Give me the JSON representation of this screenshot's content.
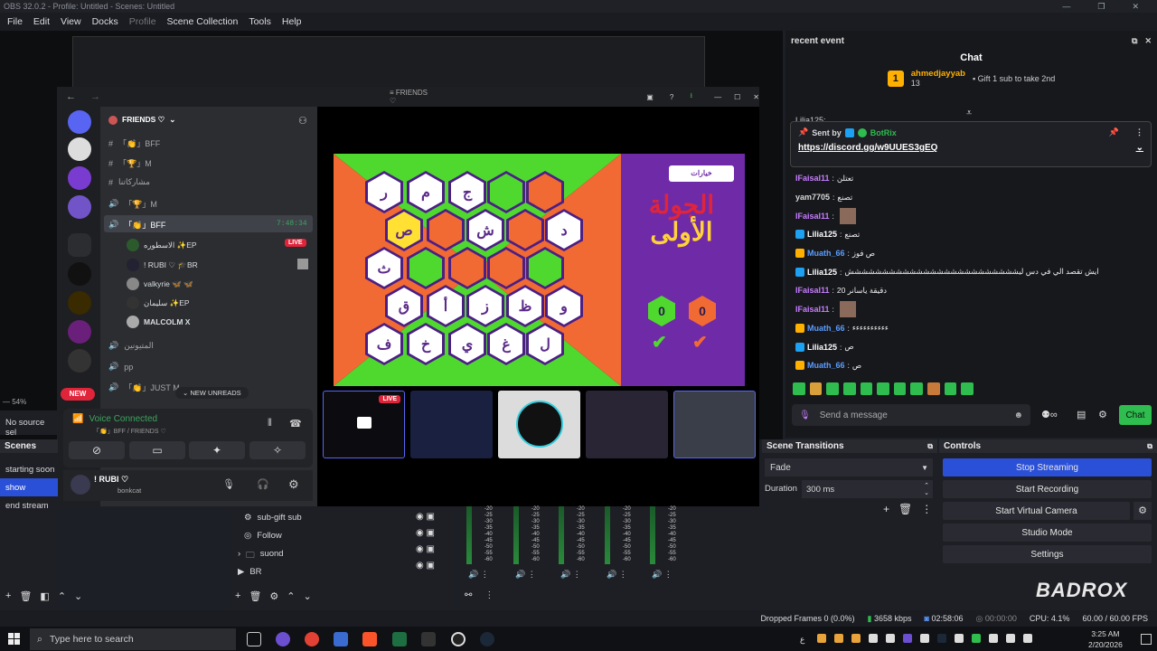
{
  "window": {
    "title": "OBS 32.0.2 - Profile: Untitled - Scenes: Untitled",
    "controls": [
      "—",
      "❐",
      "✕"
    ]
  },
  "menu": [
    "File",
    "Edit",
    "View",
    "Docks",
    "Profile",
    "Scene Collection",
    "Tools",
    "Help"
  ],
  "preview": {
    "zoom": "54%",
    "no_source": "No source sel"
  },
  "discord": {
    "server_title": "FRIENDS ♡",
    "window_title": "FRIENDS ♡",
    "channels": [
      {
        "name": "「👏」BFF",
        "type": "text"
      },
      {
        "name": "「🏆」M",
        "type": "text"
      },
      {
        "name": "مشاركاتنا",
        "type": "text"
      },
      {
        "name": "「🏆」M",
        "type": "voice"
      },
      {
        "name": "「👏」BFF",
        "type": "voice",
        "time": "7:48:34"
      }
    ],
    "voice_users": [
      {
        "name": "الاسطوره ✨EP",
        "live": "LIVE"
      },
      {
        "name": "! RUBI ♡ 🎓BR"
      },
      {
        "name": "valkyrie 🦋 🦋"
      },
      {
        "name": "سليمان ✨EP"
      },
      {
        "name": "MALCOLM X"
      }
    ],
    "more_channels": [
      "المتيونين",
      "pp",
      "「👏」JUST M"
    ],
    "new_label": "NEW",
    "new_unreads": "NEW UNREADS",
    "voice_connected": "Voice Connected",
    "voice_sub": "「👏」BFF / FRIENDS ♡",
    "user_name": "! RUBI ♡",
    "user_status": "bonkcat"
  },
  "game": {
    "title_line1": "الجولة",
    "title_line2": "الأولى",
    "button": "خيارات",
    "score_green": "0",
    "score_orange": "0",
    "hexes": [
      "ر",
      "م",
      "ج",
      "",
      "",
      "ص",
      "",
      "ش",
      "",
      "د",
      "ث",
      "",
      "",
      "",
      "",
      "ق",
      "أ",
      "ز",
      "ظ",
      "و",
      "ف",
      "خ",
      "ي",
      "غ",
      "ل"
    ],
    "live": "LIVE"
  },
  "recent_event": {
    "title": "recent event",
    "chat_title": "Chat",
    "gift_user": "ahmedjayyab",
    "gift_count": "13",
    "gift_text": "Gift 1 sub to take 2nd",
    "gift_rank": "1"
  },
  "pinned": {
    "sent_by": "Sent by",
    "bot": "BotRix",
    "link": "https://discord.gg/w9UUES3gEQ",
    "hidden_line": "Lilia125:"
  },
  "chat": [
    {
      "user": "IFaisal11",
      "color": "#c77dff",
      "text": "تعتلن"
    },
    {
      "user": "yam7705",
      "color": "#d8d8d8",
      "text": "تصنع"
    },
    {
      "user": "IFaisal11",
      "color": "#c77dff",
      "text": ""
    },
    {
      "user": "Lilia125",
      "color": "#ffffff",
      "text": "تصنع"
    },
    {
      "user": "Muath_66",
      "color": "#5b9cff",
      "text": "ص فوز"
    },
    {
      "user": "Lilia125",
      "color": "#ffffff",
      "text": "ايش تقصد الي في دس ليششششششششششششششششششششششششش"
    },
    {
      "user": "IFaisal11",
      "color": "#c77dff",
      "text": "دقيقة ياسانر 20"
    },
    {
      "user": "IFaisal11",
      "color": "#c77dff",
      "text": ""
    },
    {
      "user": "Muath_66",
      "color": "#5b9cff",
      "text": "ءءءءءءءءءء"
    },
    {
      "user": "Lilia125",
      "color": "#ffffff",
      "text": "ص"
    },
    {
      "user": "Muath_66",
      "color": "#5b9cff",
      "text": "ص"
    }
  ],
  "chat_input": {
    "placeholder": "Send a message",
    "button": "Chat"
  },
  "scenes": {
    "title": "Scenes",
    "items": [
      "starting soon",
      "show",
      "end stream"
    ],
    "selected": "show"
  },
  "sources": {
    "items": [
      "sub-gift sub",
      "Follow",
      "suond",
      "BR"
    ]
  },
  "transitions": {
    "title": "Scene Transitions",
    "type": "Fade",
    "duration_label": "Duration",
    "duration": "300 ms"
  },
  "controls": {
    "title": "Controls",
    "stop_streaming": "Stop Streaming",
    "start_recording": "Start Recording",
    "start_virtual_camera": "Start Virtual Camera",
    "studio_mode": "Studio Mode",
    "settings": "Settings"
  },
  "mixer": {
    "ticks": [
      "-20",
      "-25",
      "-30",
      "-35",
      "-40",
      "-45",
      "-50",
      "-55",
      "-60"
    ]
  },
  "statusbar": {
    "dropped": "Dropped Frames 0 (0.0%)",
    "kbps": "3658 kbps",
    "stream_time": "02:58:06",
    "rec_time": "00:00:00",
    "cpu": "CPU: 4.1%",
    "fps": "60.00 / 60.00 FPS"
  },
  "taskbar": {
    "search": "Type here to search",
    "time": "3:25 AM",
    "date": "2/20/2026",
    "lang": "ع"
  },
  "logo": "BADROX",
  "colors": {
    "accent_blue": "#2b50d8",
    "chat_green": "#2ebd4e",
    "live_red": "#e0243a",
    "game_green": "#4fd92e",
    "game_orange": "#f26a33",
    "game_purple": "#6f2aa8"
  }
}
